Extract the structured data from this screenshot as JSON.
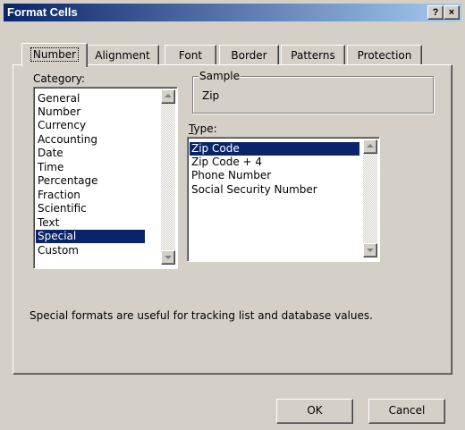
{
  "window": {
    "title": "Format Cells",
    "help_button": "?",
    "close_button": "×"
  },
  "tabs": [
    "Number",
    "Alignment",
    "Font",
    "Border",
    "Patterns",
    "Protection"
  ],
  "category": {
    "label": "Category:",
    "items": [
      "General",
      "Number",
      "Currency",
      "Accounting",
      "Date",
      "Time",
      "Percentage",
      "Fraction",
      "Scientific",
      "Text",
      "Special",
      "Custom"
    ],
    "selected": "Special"
  },
  "sample": {
    "label": "Sample",
    "value": "Zip"
  },
  "type": {
    "label": "Type:",
    "items": [
      "Zip Code",
      "Zip Code + 4",
      "Phone Number",
      "Social Security Number"
    ],
    "selected": "Zip Code"
  },
  "description": "Special formats are useful for tracking list and database values.",
  "buttons": {
    "ok": "OK",
    "cancel": "Cancel"
  },
  "colors": {
    "face": "#d4d0c8",
    "selection": "#0a246a",
    "title_start": "#0a246a",
    "title_end": "#a6caf0"
  }
}
